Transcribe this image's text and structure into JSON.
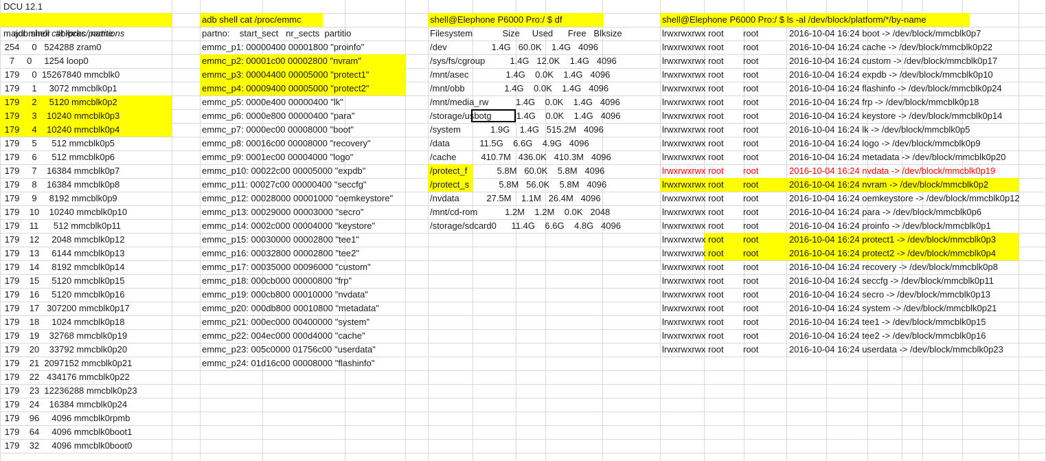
{
  "title": "DCU 12.1",
  "partitions": {
    "heading_prefix": "adb shell ",
    "heading_cmd": "cat /proc/partitions",
    "header": "major minor  #blocks  name",
    "rows": [
      " 254     0   524288 zram0",
      "   7     0     1254 loop0",
      " 179     0  15267840 mmcblk0",
      " 179     1     3072 mmcblk0p1",
      " 179     2     5120 mmcblk0p2",
      " 179     3    10240 mmcblk0p3",
      " 179     4    10240 mmcblk0p4",
      " 179     5      512 mmcblk0p5",
      " 179     6      512 mmcblk0p6",
      " 179     7    16384 mmcblk0p7",
      " 179     8    16384 mmcblk0p8",
      " 179     9     8192 mmcblk0p9",
      " 179    10    10240 mmcblk0p10",
      " 179    11      512 mmcblk0p11",
      " 179    12     2048 mmcblk0p12",
      " 179    13     6144 mmcblk0p13",
      " 179    14     8192 mmcblk0p14",
      " 179    15     5120 mmcblk0p15",
      " 179    16     5120 mmcblk0p16",
      " 179    17   307200 mmcblk0p17",
      " 179    18     1024 mmcblk0p18",
      " 179    19    32768 mmcblk0p19",
      " 179    20    33792 mmcblk0p20",
      " 179    21  2097152 mmcblk0p21",
      " 179    22   434176 mmcblk0p22",
      " 179    23  12236288 mmcblk0p23",
      " 179    24    16384 mmcblk0p24",
      " 179    96     4096 mmcblk0rpmb",
      " 179    64     4096 mmcblk0boot1",
      " 179    32     4096 mmcblk0boot0"
    ]
  },
  "emmc": {
    "heading": "adb shell cat /proc/emmc",
    "header": "partno:    start_sect   nr_sects  partitio",
    "rows": [
      "emmc_p1: 00000400 00001800 \"proinfo\"",
      "emmc_p2: 00001c00 00002800 \"nvram\"",
      "emmc_p3: 00004400 00005000 \"protect1\"",
      "emmc_p4: 00009400 00005000 \"protect2\"",
      "emmc_p5: 0000e400 00000400 \"lk\"",
      "emmc_p6: 0000e800 00000400 \"para\"",
      "emmc_p7: 0000ec00 00008000 \"boot\"",
      "emmc_p8: 00016c00 00008000 \"recovery\"",
      "emmc_p9: 0001ec00 00004000 \"logo\"",
      "emmc_p10: 00022c00 00005000 \"expdb\"",
      "emmc_p11: 00027c00 00000400 \"seccfg\"",
      "emmc_p12: 00028000 00001000 \"oemkeystore\"",
      "emmc_p13: 00029000 00003000 \"secro\"",
      "emmc_p14: 0002c000 00004000 \"keystore\"",
      "emmc_p15: 00030000 00002800 \"tee1\"",
      "emmc_p16: 00032800 00002800 \"tee2\"",
      "emmc_p17: 00035000 00096000 \"custom\"",
      "emmc_p18: 000cb000 00000800 \"frp\"",
      "emmc_p19: 000cb800 00010000 \"nvdata\"",
      "emmc_p20: 000db800 00010800 \"metadata\"",
      "emmc_p21: 000ec000 00400000 \"system\"",
      "emmc_p22: 004ec000 000d4000 \"cache\"",
      "emmc_p23: 005c0000 01756c00 \"userdata\"",
      "emmc_p24: 01d16c00 00008000 \"flashinfo\""
    ]
  },
  "df": {
    "heading": "shell@Elephone P6000 Pro:/ $ df",
    "header": "Filesystem            Size     Used      Free   Blksize",
    "rows": [
      "/dev                  1.4G   60.0K    1.4G   4096",
      "/sys/fs/cgroup          1.4G   12.0K    1.4G   4096",
      "/mnt/asec               1.4G    0.0K    1.4G   4096",
      "/mnt/obb                1.4G    0.0K    1.4G   4096",
      "/mnt/media_rw           1.4G    0.0K    1.4G   4096",
      "/storage/usbotg          1.4G    0.0K    1.4G   4096",
      "/system            1.9G    1.4G   515.2M   4096",
      "/data            11.5G    6.6G    4.9G   4096",
      "/cache          410.7M   436.0K   410.3M   4096",
      "/protect_f            5.8M   60.0K    5.8M   4096",
      "/protect_s            5.8M   56.0K    5.8M   4096",
      "/nvdata           27.5M    1.1M   26.4M   4096",
      "/mnt/cd-rom           1.2M    1.2M    0.0K   2048",
      "/storage/sdcard0      11.4G    6.6G    4.8G   4096"
    ]
  },
  "byname": {
    "heading": "shell@Elephone P6000 Pro:/ $ ls -al /dev/block/platform/*/by-name",
    "rows": [
      {
        "perm": "lrwxrwxrwx root",
        "owner": "root",
        "link": "2016-10-04 16:24 boot -> /dev/block/mmcblk0p7"
      },
      {
        "perm": "lrwxrwxrwx root",
        "owner": "root",
        "link": "2016-10-04 16:24 cache -> /dev/block/mmcblk0p22"
      },
      {
        "perm": "lrwxrwxrwx root",
        "owner": "root",
        "link": "2016-10-04 16:24 custom -> /dev/block/mmcblk0p17"
      },
      {
        "perm": "lrwxrwxrwx root",
        "owner": "root",
        "link": "2016-10-04 16:24 expdb -> /dev/block/mmcblk0p10"
      },
      {
        "perm": "lrwxrwxrwx root",
        "owner": "root",
        "link": "2016-10-04 16:24 flashinfo -> /dev/block/mmcblk0p24"
      },
      {
        "perm": "lrwxrwxrwx root",
        "owner": "root",
        "link": "2016-10-04 16:24 frp -> /dev/block/mmcblk0p18"
      },
      {
        "perm": "lrwxrwxrwx root",
        "owner": "root",
        "link": "2016-10-04 16:24 keystore -> /dev/block/mmcblk0p14"
      },
      {
        "perm": "lrwxrwxrwx root",
        "owner": "root",
        "link": "2016-10-04 16:24 lk -> /dev/block/mmcblk0p5"
      },
      {
        "perm": "lrwxrwxrwx root",
        "owner": "root",
        "link": "2016-10-04 16:24 logo -> /dev/block/mmcblk0p9"
      },
      {
        "perm": "lrwxrwxrwx root",
        "owner": "root",
        "link": "2016-10-04 16:24 metadata -> /dev/block/mmcblk0p20"
      },
      {
        "perm": "lrwxrwxrwx root",
        "owner": "root",
        "link": "2016-10-04 16:24 nvdata -> /dev/block/mmcblk0p19"
      },
      {
        "perm": "lrwxrwxrwx root",
        "owner": "root",
        "link": "2016-10-04 16:24 nvram -> /dev/block/mmcblk0p2"
      },
      {
        "perm": "lrwxrwxrwx root",
        "owner": "root",
        "link": "2016-10-04 16:24 oemkeystore -> /dev/block/mmcblk0p12"
      },
      {
        "perm": "lrwxrwxrwx root",
        "owner": "root",
        "link": "2016-10-04 16:24 para -> /dev/block/mmcblk0p6"
      },
      {
        "perm": "lrwxrwxrwx root",
        "owner": "root",
        "link": "2016-10-04 16:24 proinfo -> /dev/block/mmcblk0p1"
      },
      {
        "perm": "lrwxrwxrwx root",
        "owner": "root",
        "link": "2016-10-04 16:24 protect1 -> /dev/block/mmcblk0p3"
      },
      {
        "perm": "lrwxrwxrwx root",
        "owner": "root",
        "link": "2016-10-04 16:24 protect2 -> /dev/block/mmcblk0p4"
      },
      {
        "perm": "lrwxrwxrwx root",
        "owner": "root",
        "link": "2016-10-04 16:24 recovery -> /dev/block/mmcblk0p8"
      },
      {
        "perm": "lrwxrwxrwx root",
        "owner": "root",
        "link": "2016-10-04 16:24 seccfg -> /dev/block/mmcblk0p11"
      },
      {
        "perm": "lrwxrwxrwx root",
        "owner": "root",
        "link": "2016-10-04 16:24 secro -> /dev/block/mmcblk0p13"
      },
      {
        "perm": "lrwxrwxrwx root",
        "owner": "root",
        "link": "2016-10-04 16:24 system -> /dev/block/mmcblk0p21"
      },
      {
        "perm": "lrwxrwxrwx root",
        "owner": "root",
        "link": "2016-10-04 16:24 tee1 -> /dev/block/mmcblk0p15"
      },
      {
        "perm": "lrwxrwxrwx root",
        "owner": "root",
        "link": "2016-10-04 16:24 tee2 -> /dev/block/mmcblk0p16"
      },
      {
        "perm": "lrwxrwxrwx root",
        "owner": "root",
        "link": "2016-10-04 16:24 userdata -> /dev/block/mmcblk0p23"
      }
    ]
  },
  "colors": {
    "highlight": "#ffff00",
    "alert_text": "#ff0000",
    "gridline": "#d9d9d9"
  }
}
